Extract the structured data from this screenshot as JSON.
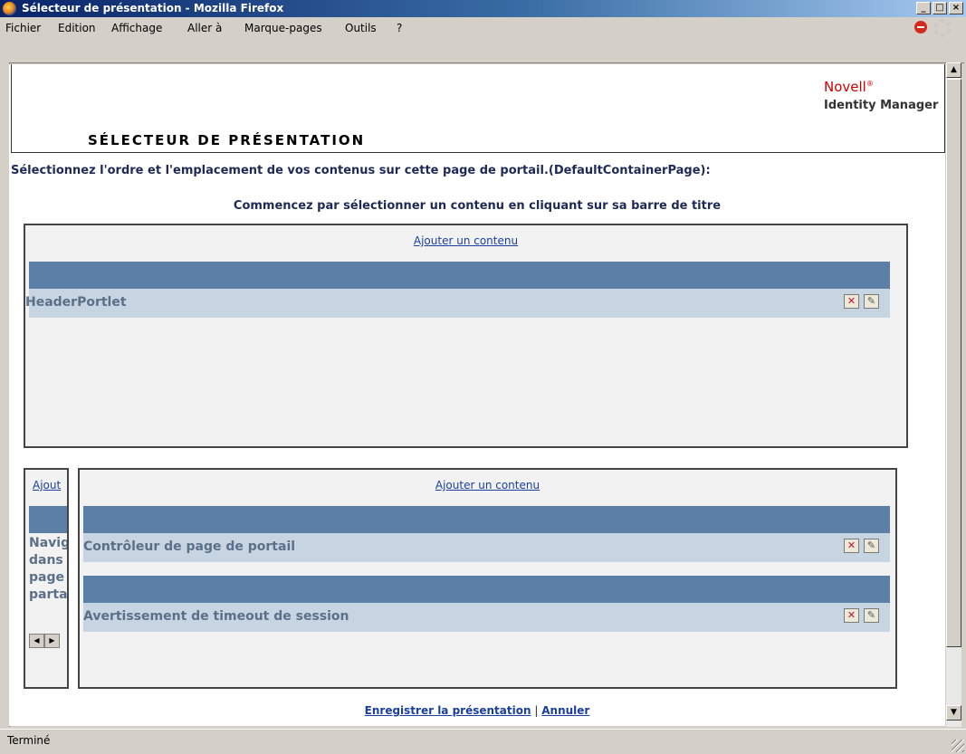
{
  "window": {
    "title": "Sélecteur de présentation - Mozilla Firefox",
    "minimize_glyph": "_",
    "maximize_glyph": "□",
    "close_glyph": "×"
  },
  "menu": {
    "items": [
      "Fichier",
      "Edition",
      "Affichage",
      "Aller à",
      "Marque-pages",
      "Outils",
      "?"
    ]
  },
  "header": {
    "brand": "Novell",
    "brand_mark": "®",
    "product": "Identity Manager",
    "page_title": "SÉLECTEUR DE PRÉSENTATION"
  },
  "intro_text": "Sélectionnez l'ordre et l'emplacement de vos contenus sur cette page de portail.(DefaultContainerPage):",
  "hint_text": "Commencez par sélectionner un contenu en cliquant sur sa barre de titre",
  "top_region": {
    "add_link": "Ajouter un contenu",
    "portlets": [
      {
        "name": "HeaderPortlet"
      }
    ]
  },
  "left_region": {
    "add_link": "Ajout",
    "portlets": [
      {
        "name_lines": [
          "Navig",
          "dans",
          "page",
          "parta"
        ]
      }
    ]
  },
  "right_region": {
    "add_link": "Ajouter un contenu",
    "portlets": [
      {
        "name": "Contrôleur de page de portail"
      },
      {
        "name": "Avertissement de timeout de session"
      }
    ]
  },
  "actions": {
    "save": "Enregistrer la présentation",
    "separator": "|",
    "cancel": "Annuler"
  },
  "portlet_buttons": {
    "delete_glyph": "✕",
    "edit_glyph": "✎"
  },
  "status": {
    "text": "Terminé"
  },
  "colors": {
    "title_gradient_start": "#0a246a",
    "portlet_bar": "#5b7fa7",
    "portlet_row": "#c7d5e2",
    "link": "#1a3f9e",
    "brand_red": "#cc0000"
  }
}
